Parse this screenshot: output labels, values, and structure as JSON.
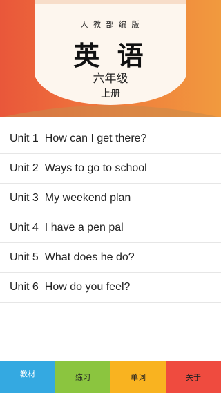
{
  "header": {
    "publisher": "人 教 部 编 版",
    "title": "英 语",
    "grade": "六年级",
    "volume": "上册",
    "colors": {
      "left": "#e9573a",
      "right": "#f19a3e",
      "cover": "#fdf6ee"
    }
  },
  "units": [
    {
      "unit": "Unit 1",
      "title": "How can I get there?"
    },
    {
      "unit": "Unit 2",
      "title": "Ways to go to school"
    },
    {
      "unit": "Unit 3",
      "title": "My weekend plan"
    },
    {
      "unit": "Unit 4",
      "title": "I have a pen pal"
    },
    {
      "unit": "Unit 5",
      "title": "What does he do?"
    },
    {
      "unit": "Unit 6",
      "title": "How do you feel?"
    }
  ],
  "tabs": [
    {
      "label": "教材",
      "color": "#34a9e1"
    },
    {
      "label": "练习",
      "color": "#8bc53f"
    },
    {
      "label": "单词",
      "color": "#f9b320"
    },
    {
      "label": "关于",
      "color": "#ef4b3f"
    }
  ]
}
